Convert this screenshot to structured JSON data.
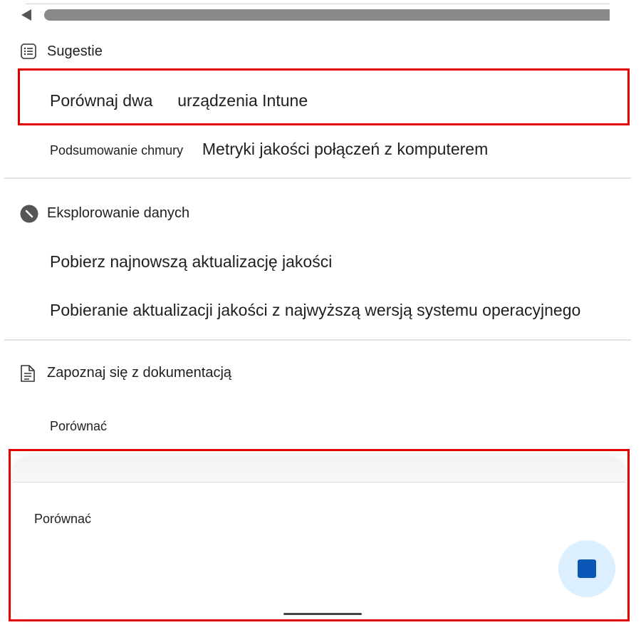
{
  "suggestions": {
    "title": "Sugestie",
    "icon": "list-icon",
    "items": [
      {
        "part1": "Porównaj dwa",
        "part2": "urządzenia Intune"
      },
      {
        "part1": "Podsumowanie chmury",
        "part2": "Metryki jakości połączeń z komputerem"
      }
    ]
  },
  "explore": {
    "title": "Eksplorowanie danych",
    "icon": "compass-icon",
    "items": [
      "Pobierz najnowszą aktualizację jakości",
      "Pobieranie aktualizacji jakości z najwyższą wersją systemu operacyjnego"
    ]
  },
  "docs": {
    "title": "Zapoznaj się z dokumentacją",
    "icon": "document-icon",
    "items": [
      "Porównać"
    ]
  },
  "composer": {
    "input_text": "Porównać",
    "stop_icon": "stop-icon",
    "stop_color": "#0b57b8",
    "highlight_color": "#e00000"
  }
}
